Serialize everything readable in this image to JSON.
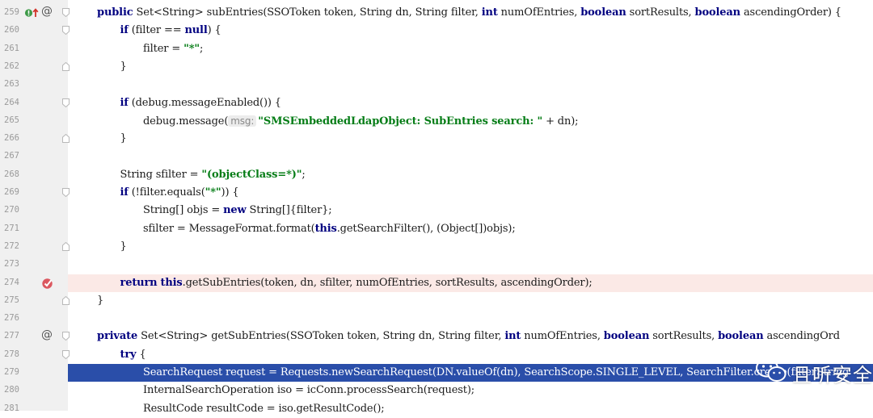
{
  "editor": {
    "colors": {
      "keyword": "#000080",
      "string": "#067d17",
      "breakpoint_line": "#fbe9e6",
      "selection_line": "#2a4ea9",
      "gutter": "#f0f0f0"
    },
    "lines": [
      {
        "number": "259",
        "marker": "override-impl",
        "fold": "start",
        "tokens": [
          [
            "kw",
            "public"
          ],
          [
            "t",
            " Set<String> subEntries(SSOToken token, String dn, String filter, "
          ],
          [
            "kw",
            "int"
          ],
          [
            "t",
            " numOfEntries, "
          ],
          [
            "kw",
            "boolean"
          ],
          [
            "t",
            " sortResults, "
          ],
          [
            "kw",
            "boolean"
          ],
          [
            "t",
            " ascendingOrder) {"
          ]
        ]
      },
      {
        "number": "260",
        "fold": "start",
        "indent": 1,
        "tokens": [
          [
            "kw",
            "if"
          ],
          [
            "t",
            " (filter == "
          ],
          [
            "kw",
            "null"
          ],
          [
            "t",
            ") {"
          ]
        ]
      },
      {
        "number": "261",
        "indent": 2,
        "tokens": [
          [
            "t",
            "filter = "
          ],
          [
            "str",
            "\"*\""
          ],
          [
            "t",
            ";"
          ]
        ]
      },
      {
        "number": "262",
        "fold": "end",
        "indent": 1,
        "tokens": [
          [
            "t",
            "}"
          ]
        ]
      },
      {
        "number": "263",
        "tokens": []
      },
      {
        "number": "264",
        "fold": "start",
        "indent": 1,
        "tokens": [
          [
            "kw",
            "if"
          ],
          [
            "t",
            " (debug.messageEnabled()) {"
          ]
        ]
      },
      {
        "number": "265",
        "indent": 2,
        "tokens": [
          [
            "t",
            "debug.message("
          ],
          [
            "hint",
            "msg:"
          ],
          [
            "str",
            "\"SMSEmbeddedLdapObject: SubEntries search: \""
          ],
          [
            "t",
            " + dn);"
          ]
        ]
      },
      {
        "number": "266",
        "fold": "end",
        "indent": 1,
        "tokens": [
          [
            "t",
            "}"
          ]
        ]
      },
      {
        "number": "267",
        "tokens": []
      },
      {
        "number": "268",
        "indent": 1,
        "tokens": [
          [
            "t",
            "String sfilter = "
          ],
          [
            "str",
            "\"(objectClass=*)\""
          ],
          [
            "t",
            ";"
          ]
        ]
      },
      {
        "number": "269",
        "fold": "start",
        "indent": 1,
        "tokens": [
          [
            "kw",
            "if"
          ],
          [
            "t",
            " (!filter.equals("
          ],
          [
            "str",
            "\"*\""
          ],
          [
            "t",
            ")) {"
          ]
        ]
      },
      {
        "number": "270",
        "indent": 2,
        "tokens": [
          [
            "t",
            "String[] objs = "
          ],
          [
            "kw",
            "new"
          ],
          [
            "t",
            " String[]{filter};"
          ]
        ]
      },
      {
        "number": "271",
        "indent": 2,
        "tokens": [
          [
            "t",
            "sfilter = MessageFormat.format("
          ],
          [
            "kw",
            "this"
          ],
          [
            "t",
            ".getSearchFilter(), (Object[])objs);"
          ]
        ]
      },
      {
        "number": "272",
        "fold": "end",
        "indent": 1,
        "tokens": [
          [
            "t",
            "}"
          ]
        ]
      },
      {
        "number": "273",
        "tokens": []
      },
      {
        "number": "274",
        "marker": "breakpoint",
        "highlight": "breakpoint",
        "indent": 1,
        "tokens": [
          [
            "kw",
            "return"
          ],
          [
            "t",
            " "
          ],
          [
            "kw",
            "this"
          ],
          [
            "t",
            ".getSubEntries(token, dn, sfilter, numOfEntries, sortResults, ascendingOrder);"
          ]
        ]
      },
      {
        "number": "275",
        "fold": "end",
        "tokens": [
          [
            "t",
            "}"
          ]
        ]
      },
      {
        "number": "276",
        "tokens": []
      },
      {
        "number": "277",
        "marker": "annotation",
        "fold": "start",
        "tokens": [
          [
            "kw",
            "private"
          ],
          [
            "t",
            " Set<String> getSubEntries(SSOToken token, String dn, String filter, "
          ],
          [
            "kw",
            "int"
          ],
          [
            "t",
            " numOfEntries, "
          ],
          [
            "kw",
            "boolean"
          ],
          [
            "t",
            " sortResults, "
          ],
          [
            "kw",
            "boolean"
          ],
          [
            "t",
            " ascendingOrd"
          ]
        ]
      },
      {
        "number": "278",
        "fold": "start",
        "indent": 1,
        "tokens": [
          [
            "kw",
            "try"
          ],
          [
            "t",
            " {"
          ]
        ]
      },
      {
        "number": "279",
        "highlight": "selection",
        "indent": 2,
        "tokens": [
          [
            "t",
            "SearchRequest request = Requests.newSearchRequest(DN.valueOf(dn), SearchScope.SINGLE_LEVEL, SearchFilter.create(filterString"
          ]
        ]
      },
      {
        "number": "280",
        "indent": 2,
        "tokens": [
          [
            "t",
            "InternalSearchOperation iso = icConn.processSearch(request);"
          ]
        ]
      },
      {
        "number": "281",
        "indent": 2,
        "tokens": [
          [
            "t",
            "ResultCode resultCode = iso.getResultCode();"
          ]
        ]
      }
    ]
  },
  "watermark": {
    "icon": "wechat-icon",
    "text": "且听安全"
  }
}
